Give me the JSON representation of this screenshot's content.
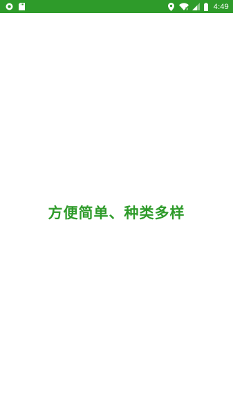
{
  "status_bar": {
    "time": "4:49",
    "background_color": "#2e9b2a",
    "left_icons": [
      "record-icon",
      "sd-card-icon"
    ],
    "right_icons": [
      "location-icon",
      "wifi-icon",
      "cell-signal-icon",
      "battery-icon"
    ]
  },
  "splash": {
    "slogan": "方便简单、种类多样",
    "slogan_color": "#2e9b2a"
  }
}
